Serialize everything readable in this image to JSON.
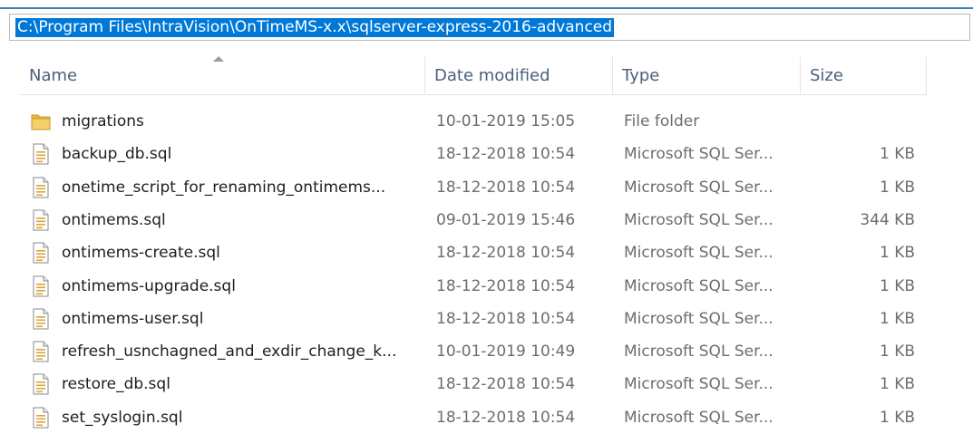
{
  "address_bar": {
    "path": "C:\\Program Files\\IntraVision\\OnTimeMS-x.x\\sqlserver-express-2016-advanced"
  },
  "columns": {
    "name": "Name",
    "date": "Date modified",
    "type": "Type",
    "size": "Size"
  },
  "files": [
    {
      "name": "migrations",
      "date": "10-01-2019 15:05",
      "type": "File folder",
      "size": "",
      "icon": "folder-icon"
    },
    {
      "name": "backup_db.sql",
      "date": "18-12-2018 10:54",
      "type": "Microsoft SQL Ser...",
      "size": "1 KB",
      "icon": "sql-file-icon"
    },
    {
      "name": "onetime_script_for_renaming_ontimems...",
      "date": "18-12-2018 10:54",
      "type": "Microsoft SQL Ser...",
      "size": "1 KB",
      "icon": "sql-file-icon"
    },
    {
      "name": "ontimems.sql",
      "date": "09-01-2019 15:46",
      "type": "Microsoft SQL Ser...",
      "size": "344 KB",
      "icon": "sql-file-icon"
    },
    {
      "name": "ontimems-create.sql",
      "date": "18-12-2018 10:54",
      "type": "Microsoft SQL Ser...",
      "size": "1 KB",
      "icon": "sql-file-icon"
    },
    {
      "name": "ontimems-upgrade.sql",
      "date": "18-12-2018 10:54",
      "type": "Microsoft SQL Ser...",
      "size": "1 KB",
      "icon": "sql-file-icon"
    },
    {
      "name": "ontimems-user.sql",
      "date": "18-12-2018 10:54",
      "type": "Microsoft SQL Ser...",
      "size": "1 KB",
      "icon": "sql-file-icon"
    },
    {
      "name": "refresh_usnchagned_and_exdir_change_k...",
      "date": "10-01-2019 10:49",
      "type": "Microsoft SQL Ser...",
      "size": "1 KB",
      "icon": "sql-file-icon"
    },
    {
      "name": "restore_db.sql",
      "date": "18-12-2018 10:54",
      "type": "Microsoft SQL Ser...",
      "size": "1 KB",
      "icon": "sql-file-icon"
    },
    {
      "name": "set_syslogin.sql",
      "date": "18-12-2018 10:54",
      "type": "Microsoft SQL Ser...",
      "size": "1 KB",
      "icon": "sql-file-icon"
    }
  ],
  "colors": {
    "selection": "#0078d7",
    "header_text": "#4c607a",
    "folder": "#e8b93a"
  }
}
